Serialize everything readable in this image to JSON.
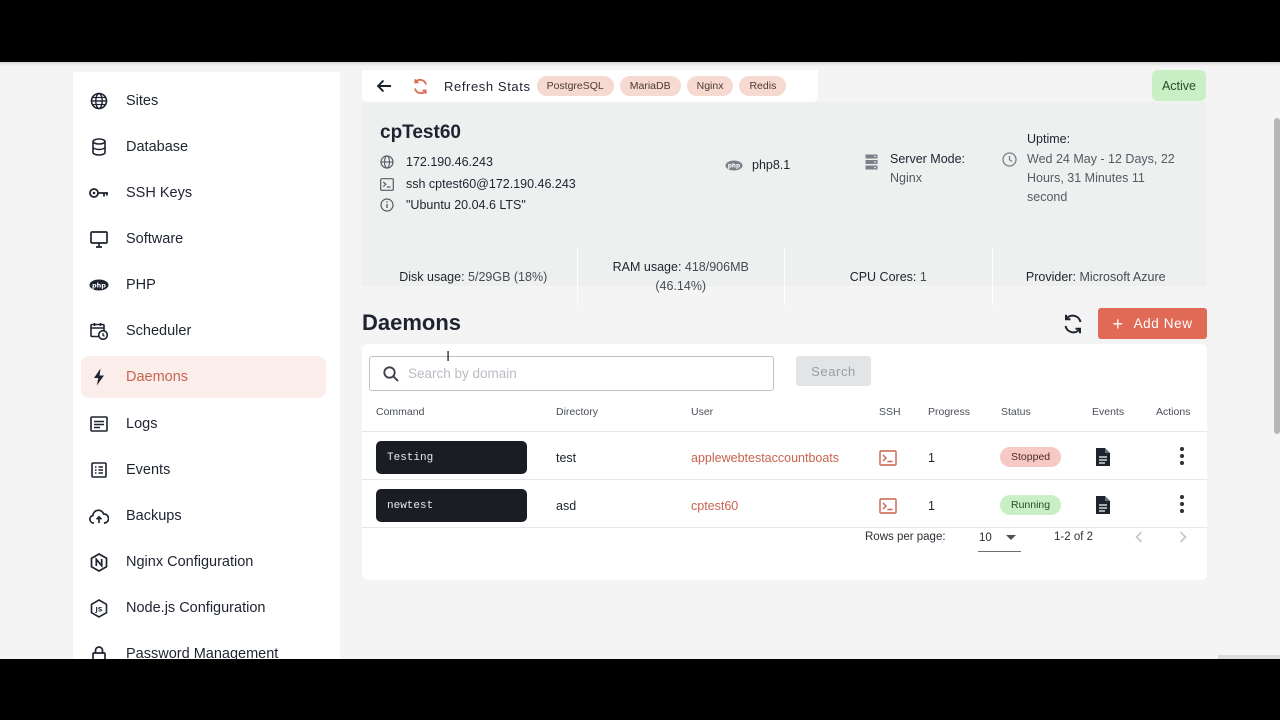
{
  "sidebar": {
    "items": [
      {
        "label": "Sites",
        "icon": "globe-icon"
      },
      {
        "label": "Database",
        "icon": "database-icon"
      },
      {
        "label": "SSH Keys",
        "icon": "key-icon"
      },
      {
        "label": "Software",
        "icon": "monitor-icon"
      },
      {
        "label": "PHP",
        "icon": "php-icon"
      },
      {
        "label": "Scheduler",
        "icon": "calendar-clock-icon"
      },
      {
        "label": "Daemons",
        "icon": "bolt-icon",
        "active": true
      },
      {
        "label": "Logs",
        "icon": "logs-icon"
      },
      {
        "label": "Events",
        "icon": "events-list-icon"
      },
      {
        "label": "Backups",
        "icon": "cloud-upload-icon"
      },
      {
        "label": "Nginx Configuration",
        "icon": "nginx-icon"
      },
      {
        "label": "Node.js Configuration",
        "icon": "nodejs-icon"
      },
      {
        "label": "Password Management",
        "icon": "lock-icon"
      }
    ]
  },
  "header": {
    "refresh_label": "Refresh Stats",
    "tech_badges": [
      "PostgreSQL",
      "MariaDB",
      "Nginx",
      "Redis"
    ],
    "status": "Active"
  },
  "server": {
    "name": "cpTest60",
    "ip": "172.190.46.243",
    "ssh": "ssh cptest60@172.190.46.243",
    "os": "\"Ubuntu 20.04.6 LTS\"",
    "php": "php8.1",
    "mode_label": "Server Mode:",
    "mode_value": "Nginx",
    "uptime_label": "Uptime:",
    "uptime_value": "Wed 24 May - 12 Days, 22 Hours, 31 Minutes 11 second",
    "stats": {
      "disk_label": "Disk usage:",
      "disk_value": "5/29GB (18%)",
      "ram_label": "RAM usage:",
      "ram_value": "418/906MB (46.14%)",
      "cpu_label": "CPU Cores:",
      "cpu_value": "1",
      "provider_label": "Provider:",
      "provider_value": "Microsoft Azure"
    }
  },
  "daemons": {
    "title": "Daemons",
    "add_label": "Add New",
    "search_placeholder": "Search by domain",
    "search_button": "Search",
    "columns": [
      "Command",
      "Directory",
      "User",
      "SSH",
      "Progress",
      "Status",
      "Events",
      "Actions"
    ],
    "rows": [
      {
        "command": "Testing",
        "directory": "test",
        "user": "applewebtestaccountboats",
        "progress": "1",
        "status": "Stopped"
      },
      {
        "command": "newtest",
        "directory": "asd",
        "user": "cptest60",
        "progress": "1",
        "status": "Running"
      }
    ],
    "pagination": {
      "rows_label": "Rows per page:",
      "rows_value": "10",
      "range": "1-2 of 2"
    }
  },
  "colors": {
    "accent": "#e06a55",
    "active_nav_bg": "#fbeeea",
    "badge_bg": "#f6d9d0",
    "status_active": "#c9f0c5",
    "status_stopped": "#f6c9c4"
  }
}
